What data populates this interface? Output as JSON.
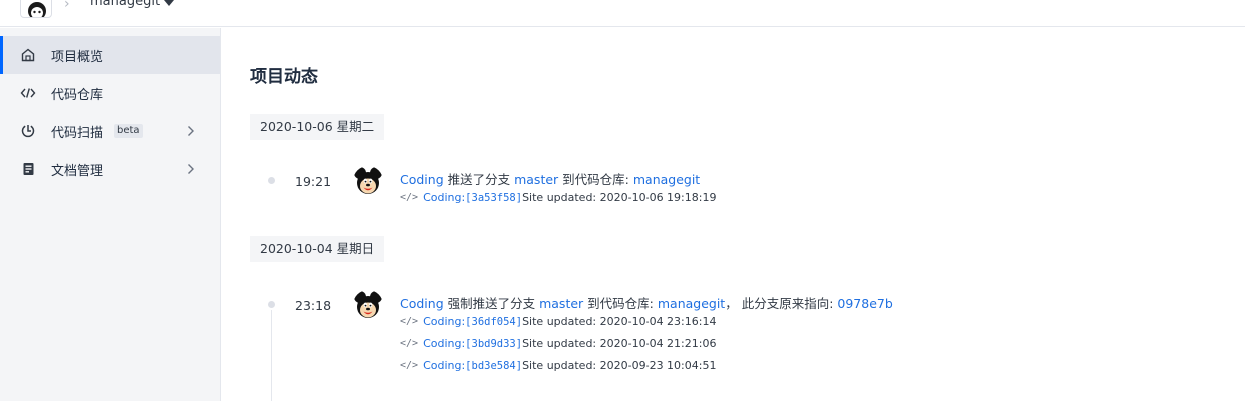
{
  "header": {
    "project_name": "managegit",
    "breadcrumb_separator": "›"
  },
  "sidebar": {
    "items": [
      {
        "label": "项目概览",
        "icon": "home-icon",
        "active": true
      },
      {
        "label": "代码仓库",
        "icon": "code-icon"
      },
      {
        "label": "代码扫描",
        "icon": "scan-icon",
        "badge": "beta",
        "expandable": true
      },
      {
        "label": "文档管理",
        "icon": "document-icon",
        "expandable": true
      }
    ]
  },
  "main": {
    "title": "项目动态",
    "groups": [
      {
        "date": "2020-10-06 星期二",
        "events": [
          {
            "time": "19:21",
            "user": "Coding",
            "action": " 推送了分支 ",
            "branch": "master",
            "to_repo_text": " 到代码仓库: ",
            "repo": "managegit",
            "extra_text": "",
            "extra_link": "",
            "commits": [
              {
                "repo": "Coding:",
                "sha": "[3a53f58]",
                "message": "Site updated: 2020-10-06 19:18:19"
              }
            ]
          }
        ]
      },
      {
        "date": "2020-10-04 星期日",
        "events": [
          {
            "time": "23:18",
            "user": "Coding",
            "action": " 强制推送了分支 ",
            "branch": "master",
            "to_repo_text": " 到代码仓库: ",
            "repo": "managegit",
            "extra_text": "， 此分支原来指向: ",
            "extra_link": "0978e7b",
            "commits": [
              {
                "repo": "Coding:",
                "sha": "[36df054]",
                "message": "Site updated: 2020-10-04 23:16:14"
              },
              {
                "repo": "Coding:",
                "sha": "[3bd9d33]",
                "message": "Site updated: 2020-10-04 21:21:06"
              },
              {
                "repo": "Coding:",
                "sha": "[bd3e584]",
                "message": "Site updated: 2020-09-23 10:04:51"
              }
            ]
          }
        ]
      }
    ]
  }
}
